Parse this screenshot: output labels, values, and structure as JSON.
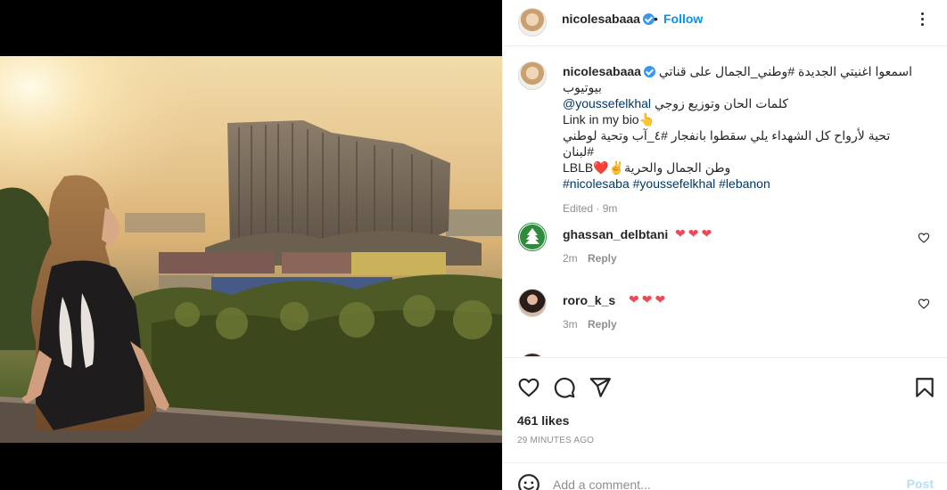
{
  "post": {
    "username": "nicolesabaaa",
    "separator": "•",
    "follow_label": "Follow",
    "caption": {
      "username": "nicolesabaaa",
      "line1": "اسمعوا اغنيتي الجديدة #وطني_الجمال على قناتي",
      "line2": "بيوتيوب",
      "line3_mention": "@youssefelkhal",
      "line3_text": "كلمات الحان وتوزيع زوجي",
      "line4": "Link in my bio👆",
      "line5": "تحية لأرواح كل الشهداء يلي سقطوا بانفجار #٤_آب وتحية لوطني #لبنان",
      "line6": "LBLB❤️✌️وطن الجمال والحرية",
      "tags": [
        "#nicolesaba",
        "#youssefelkhal",
        "#lebanon"
      ]
    },
    "edited_label": "Edited · 9m",
    "comments": [
      {
        "username": "ghassan_delbtani",
        "text": "❤❤❤",
        "time": "2m",
        "reply_label": "Reply"
      },
      {
        "username": "roro_k_s",
        "text": "❤❤❤",
        "time": "3m",
        "reply_label": "Reply"
      }
    ],
    "likes": "461 likes",
    "time_ago": "29 MINUTES AGO",
    "comment_placeholder": "Add a comment...",
    "post_label": "Post"
  },
  "icons": {
    "more": "more-options-icon",
    "like": "heart-icon",
    "comment": "comment-icon",
    "share": "share-icon",
    "save": "bookmark-icon",
    "emoji": "emoji-icon"
  },
  "colors": {
    "accent": "#0095f6",
    "heart": "#ed4956",
    "link": "#00376b",
    "muted": "#8e8e8e"
  }
}
